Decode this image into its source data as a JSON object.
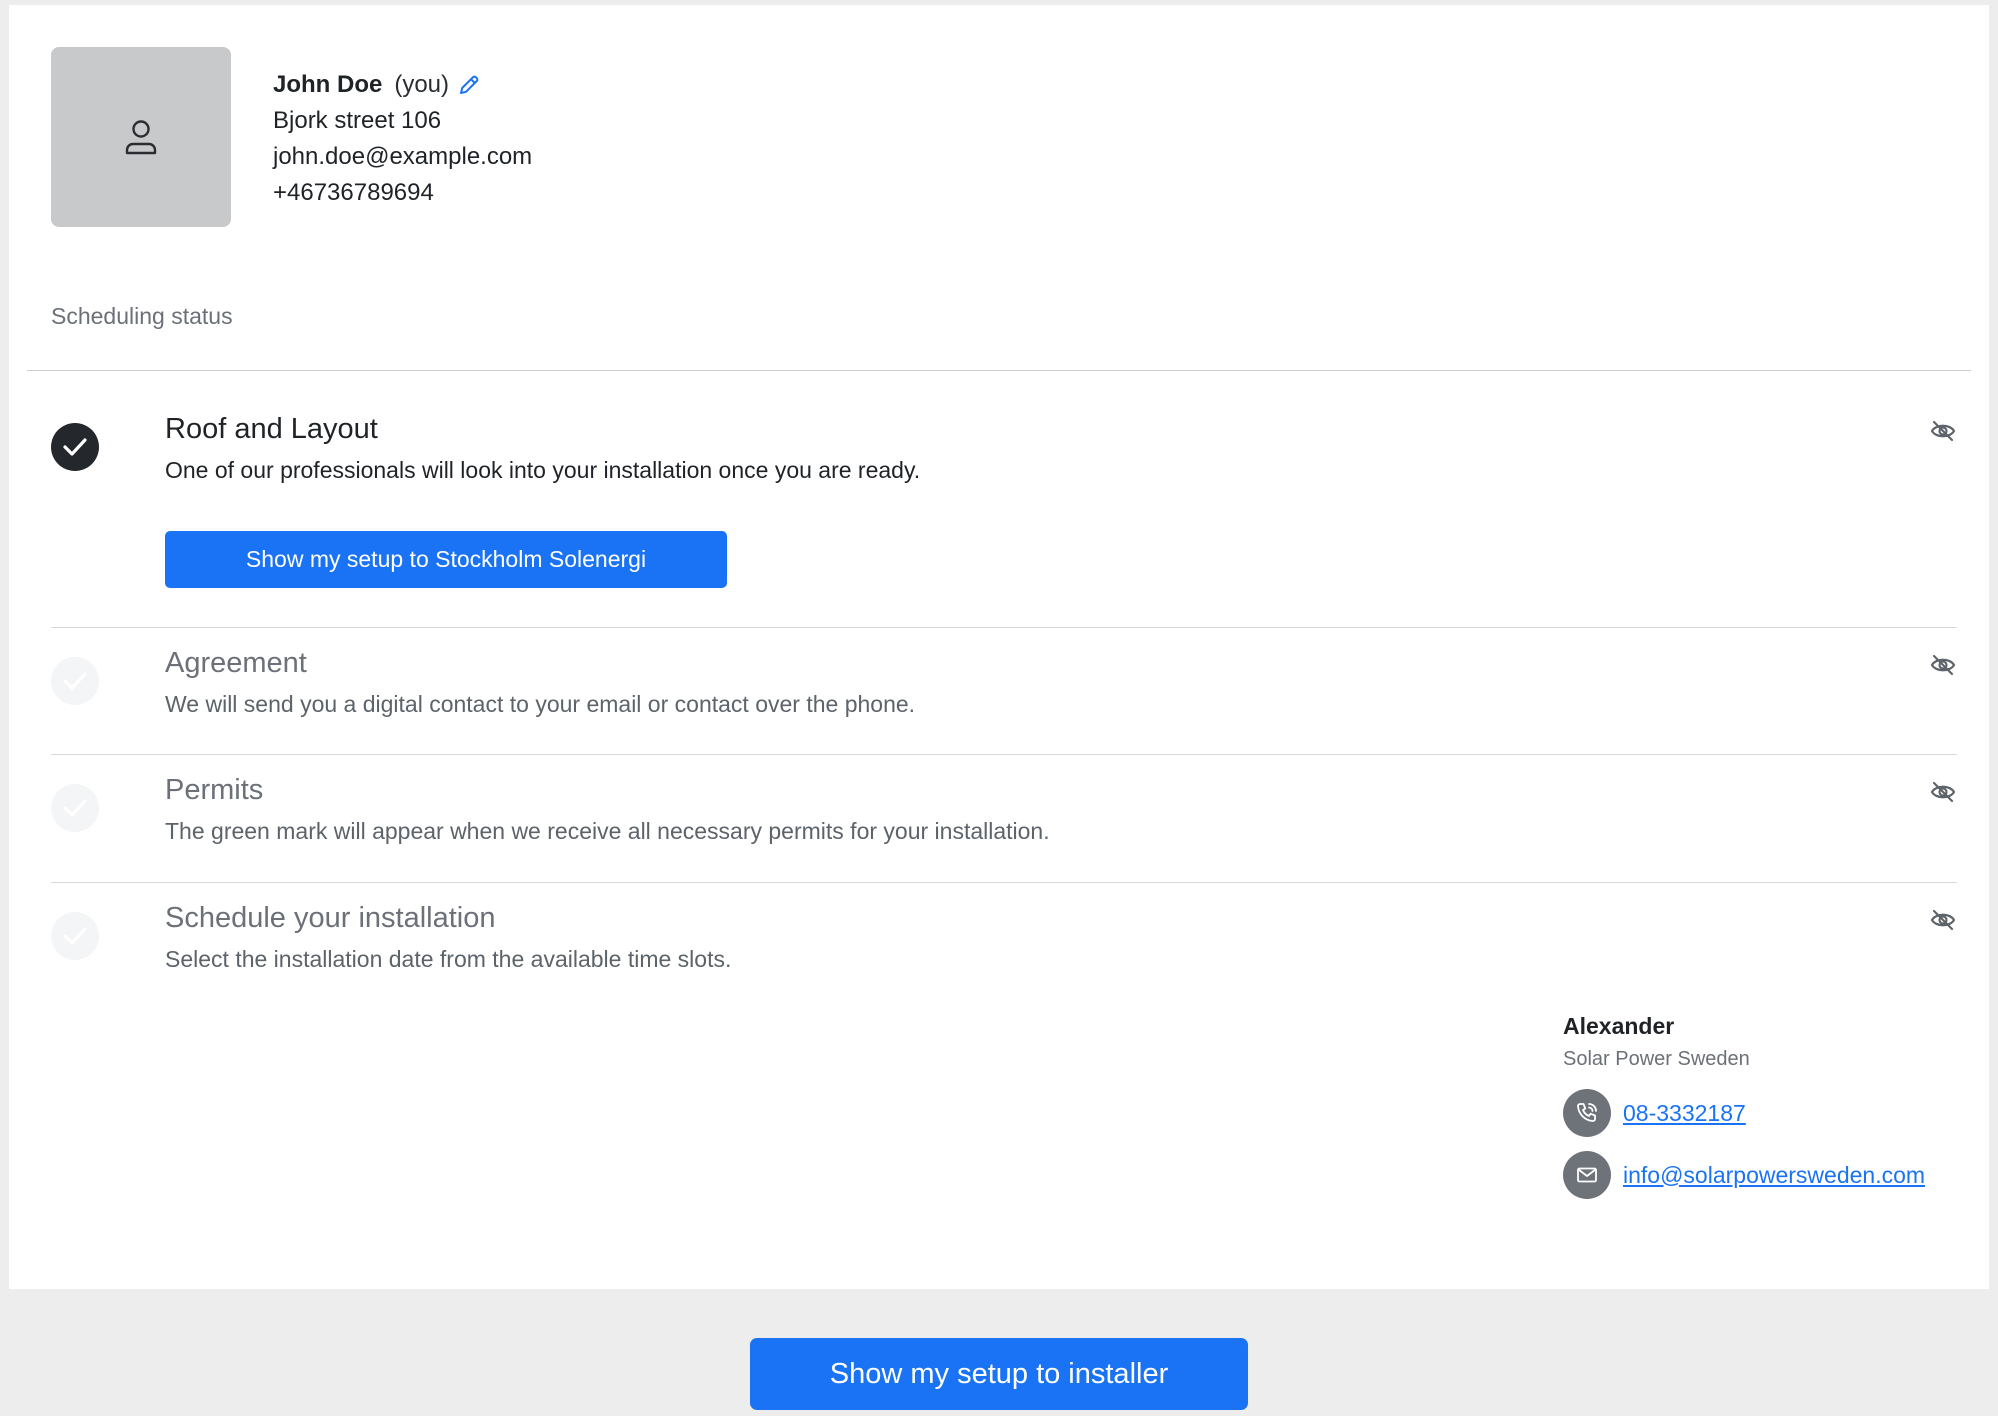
{
  "profile": {
    "avatar_icon": "user-icon",
    "name": "John Doe",
    "you_label": "(you)",
    "edit_icon": "pencil-icon",
    "address": "Bjork street 106",
    "email": "john.doe@example.com",
    "phone": "+46736789694"
  },
  "scheduling": {
    "label": "Scheduling status",
    "steps": [
      {
        "title": "Roof and Layout",
        "description": "One of our professionals will look into your installation once you are ready.",
        "status": "done",
        "button_label": "Show my setup to Stockholm Solenergi",
        "visibility_icon": "eye-off-icon"
      },
      {
        "title": "Agreement",
        "description": "We will send you a digital contact to your email or contact over the phone.",
        "status": "pending",
        "visibility_icon": "eye-off-icon"
      },
      {
        "title": "Permits",
        "description": "The green mark will appear when we receive all necessary permits for your installation.",
        "status": "pending",
        "visibility_icon": "eye-off-icon"
      },
      {
        "title": "Schedule your installation",
        "description": "Select the installation date from the available time slots.",
        "status": "pending",
        "visibility_icon": "eye-off-icon"
      }
    ]
  },
  "contact": {
    "name": "Alexander",
    "company": "Solar Power Sweden",
    "phone_icon": "phone-icon",
    "phone": "08-3332187",
    "email_icon": "mail-icon",
    "email": "info@solarpowersweden.com"
  },
  "footer": {
    "installer_button_label": "Show my setup to installer"
  },
  "colors": {
    "accent": "#1a73f5",
    "done_check": "#24272b",
    "pending_check": "#f4f5f6",
    "page_background": "#ededed"
  }
}
